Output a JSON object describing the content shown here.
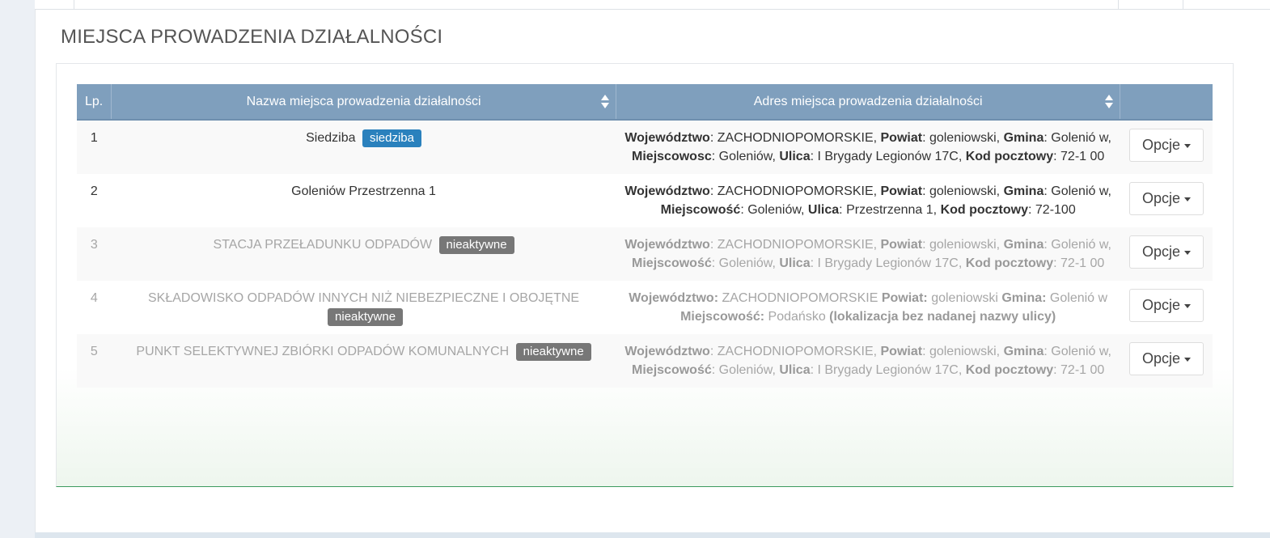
{
  "section": {
    "title": "MIEJSCA PROWADZENIA DZIAŁALNOŚCI"
  },
  "table": {
    "headers": {
      "lp": "Lp.",
      "name": "Nazwa miejsca prowadzenia działalności",
      "address": "Adres miejsca prowadzenia działalności",
      "options": ""
    },
    "options_label": "Opcje",
    "rows": [
      {
        "lp": "1",
        "name": "Siedziba",
        "badge": "siedziba",
        "badge_color": "#2a81bd",
        "active": true,
        "addr": {
          "woj_label": "Województwo",
          "woj_sep": ": ",
          "woj": "ZACHODNIOPOMORSKIE, ",
          "pow_label": "Powiat",
          "pow_sep": ": ",
          "pow": "goleniowski, ",
          "gmina_label": "Gmina",
          "gmina_sep": ": ",
          "gmina": "Golenió w, ",
          "miejsc_label": "Miejscowosc",
          "miejsc_sep": ": ",
          "miejsc": "Goleniów, ",
          "ulica_label": "Ulica",
          "ulica_sep": ": ",
          "ulica": "I Brygady Legionów 17C, ",
          "kod_label": "Kod pocztowy",
          "kod_sep": ": ",
          "kod": "72-1 00"
        }
      },
      {
        "lp": "2",
        "name": "Goleniów Przestrzenna 1",
        "badge": "",
        "badge_color": "",
        "active": true,
        "addr": {
          "woj_label": "Województwo",
          "woj_sep": ": ",
          "woj": "ZACHODNIOPOMORSKIE, ",
          "pow_label": "Powiat",
          "pow_sep": ": ",
          "pow": "goleniowski, ",
          "gmina_label": "Gmina",
          "gmina_sep": ": ",
          "gmina": "Golenió w, ",
          "miejsc_label": "Miejscowość",
          "miejsc_sep": ": ",
          "miejsc": "Goleniów, ",
          "ulica_label": "Ulica",
          "ulica_sep": ": ",
          "ulica": "Przestrzenna 1, ",
          "kod_label": "Kod pocztowy",
          "kod_sep": ": ",
          "kod": "72-100"
        }
      },
      {
        "lp": "3",
        "name": "STACJA PRZEŁADUNKU ODPADÓW",
        "badge": "nieaktywne",
        "badge_color": "#777777",
        "active": false,
        "addr": {
          "woj_label": "Województwo",
          "woj_sep": ": ",
          "woj": "ZACHODNIOPOMORSKIE, ",
          "pow_label": "Powiat",
          "pow_sep": ": ",
          "pow": "goleniowski, ",
          "gmina_label": "Gmina",
          "gmina_sep": ": ",
          "gmina": "Golenió w, ",
          "miejsc_label": "Miejscowość",
          "miejsc_sep": ": ",
          "miejsc": "Goleniów, ",
          "ulica_label": "Ulica",
          "ulica_sep": ": ",
          "ulica": "I Brygady Legionów 17C, ",
          "kod_label": "Kod pocztowy",
          "kod_sep": ": ",
          "kod": "72-1 00"
        }
      },
      {
        "lp": "4",
        "name": "SKŁADOWISKO ODPADÓW INNYCH NIŻ NIEBEZPIECZNE I OBOJĘTNE",
        "badge": "nieaktywne",
        "badge_color": "#777777",
        "active": false,
        "addr": {
          "woj_label": "Województwo:",
          "woj_sep": " ",
          "woj": "ZACHODNIOPOMORSKIE ",
          "pow_label": "Powiat:",
          "pow_sep": " ",
          "pow": "goleniowski ",
          "gmina_label": "Gmina:",
          "gmina_sep": " ",
          "gmina": "Golenió w ",
          "miejsc_label": "Miejscowość:",
          "miejsc_sep": " ",
          "miejsc": "Podańsko ",
          "ulica_label": "(lokalizacja bez nadanej nazwy ulicy)",
          "ulica_sep": "",
          "ulica": "",
          "kod_label": "",
          "kod_sep": "",
          "kod": ""
        }
      },
      {
        "lp": "5",
        "name": "PUNKT SELEKTYWNEJ ZBIÓRKI ODPADÓW KOMUNALNYCH",
        "badge": "nieaktywne",
        "badge_color": "#777777",
        "active": false,
        "addr": {
          "woj_label": "Województwo",
          "woj_sep": ": ",
          "woj": "ZACHODNIOPOMORSKIE, ",
          "pow_label": "Powiat",
          "pow_sep": ": ",
          "pow": "goleniowski, ",
          "gmina_label": "Gmina",
          "gmina_sep": ": ",
          "gmina": "Golenió w, ",
          "miejsc_label": "Miejscowość",
          "miejsc_sep": ": ",
          "miejsc": "Goleniów, ",
          "ulica_label": "Ulica",
          "ulica_sep": ": ",
          "ulica": "I Brygady Legionów 17C, ",
          "kod_label": "Kod pocztowy",
          "kod_sep": ": ",
          "kod": "72-1 00"
        }
      }
    ]
  },
  "colors": {
    "header_bg": "#7f9fbd",
    "badge_primary": "#2a81bd",
    "badge_inactive": "#777777",
    "box_bottom_border": "#3c9a5f"
  },
  "icons": {
    "sort": "sort-icon",
    "caret": "caret-down-icon"
  }
}
